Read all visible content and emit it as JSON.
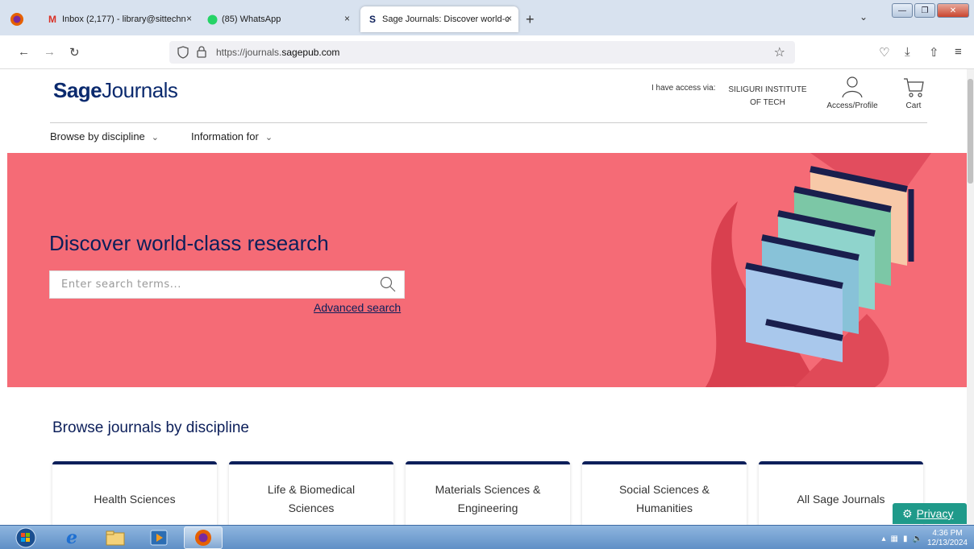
{
  "browser": {
    "tabs": [
      {
        "label": "Inbox (2,177) - library@sittechn",
        "close": "×"
      },
      {
        "label": "(85) WhatsApp",
        "close": "×"
      },
      {
        "label": "Sage Journals: Discover world-c",
        "close": "×"
      }
    ],
    "new_tab": "+",
    "url_prefix": "https://journals.",
    "url_domain": "sagepub.com"
  },
  "header": {
    "logo_bold": "Sage",
    "logo_rest": "Journals",
    "access_label": "I have access via:",
    "institution": "SILIGURI INSTITUTE OF TECH",
    "profile_label": "Access/Profile",
    "cart_label": "Cart"
  },
  "nav": {
    "browse_label": "Browse by discipline",
    "info_label": "Information for"
  },
  "hero": {
    "title": "Discover world-class research",
    "search_placeholder": "Enter search terms...",
    "advanced_search": "Advanced search"
  },
  "disciplines": {
    "title": "Browse journals by discipline",
    "cards": [
      "Health Sciences",
      "Life & Biomedical Sciences",
      "Materials Sciences & Engineering",
      "Social Sciences & Humanities",
      "All Sage Journals"
    ]
  },
  "privacy": {
    "label": "Privacy"
  },
  "taskbar": {
    "time": "4:36 PM",
    "date": "12/13/2024"
  },
  "colors": {
    "hero": "#f56b76",
    "navy": "#0c1f5a",
    "privacy": "#1f9a8a"
  }
}
